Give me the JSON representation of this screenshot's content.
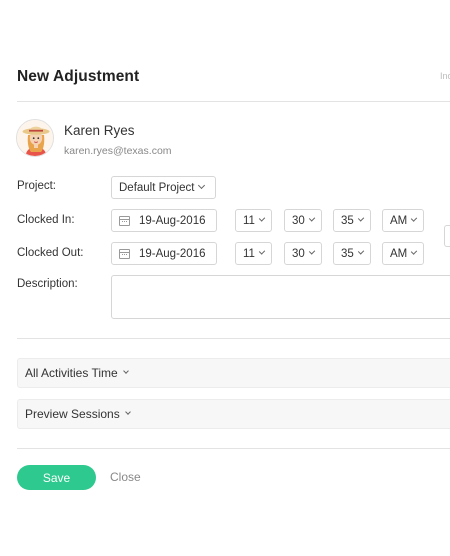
{
  "header": {
    "title": "New Adjustment",
    "corner_text": "Inc"
  },
  "user": {
    "name": "Karen Ryes",
    "email": "karen.ryes@texas.com"
  },
  "form": {
    "project_label": "Project:",
    "project_value": "Default Project",
    "clocked_in_label": "Clocked In:",
    "clocked_in": {
      "date": "19-Aug-2016",
      "hour": "11",
      "minute": "30",
      "second": "35",
      "ampm": "AM"
    },
    "clocked_out_label": "Clocked Out:",
    "clocked_out": {
      "date": "19-Aug-2016",
      "hour": "11",
      "minute": "30",
      "second": "35",
      "ampm": "AM"
    },
    "description_label": "Description:"
  },
  "sections": {
    "activities": "All Activities Time",
    "preview": "Preview Sessions"
  },
  "footer": {
    "save": "Save",
    "close": "Close"
  },
  "colors": {
    "accent": "#2ec98f"
  }
}
